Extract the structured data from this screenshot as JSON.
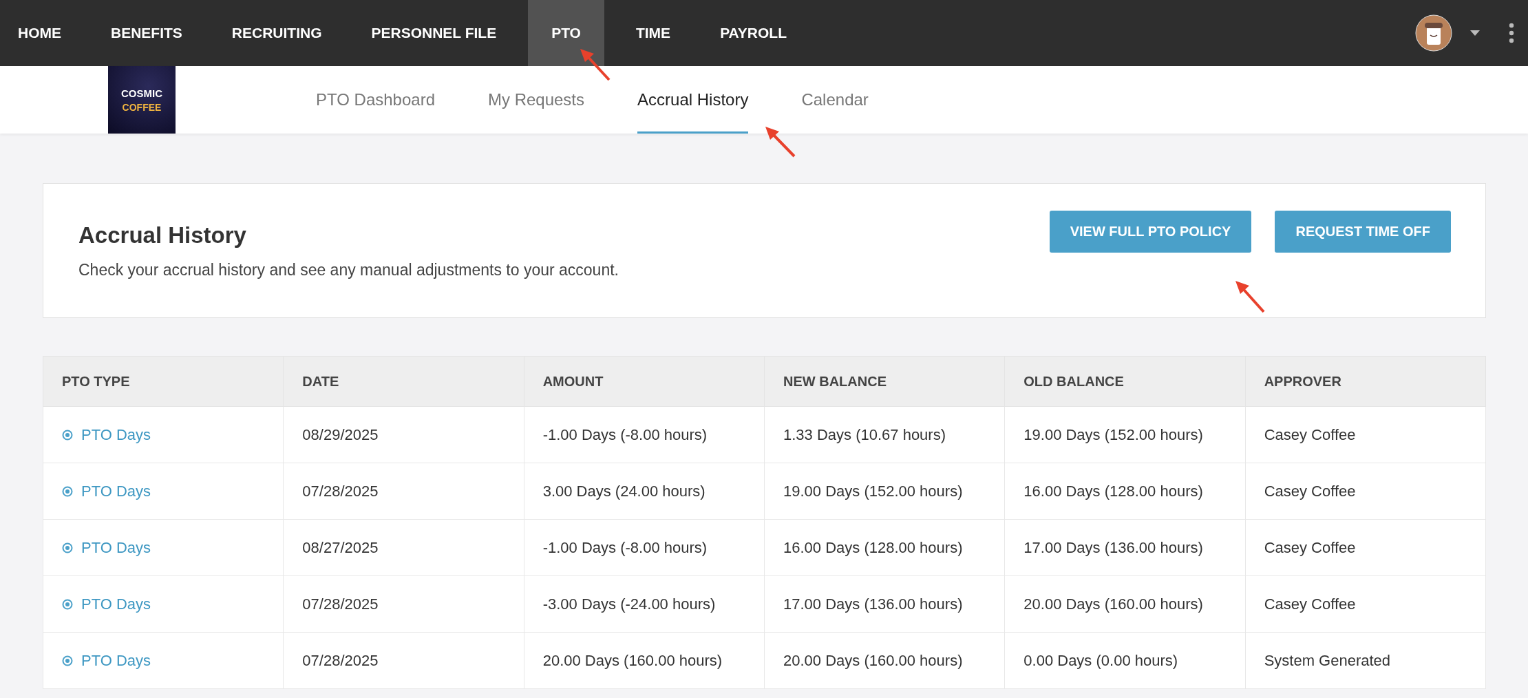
{
  "top_nav": {
    "items": [
      {
        "label": "HOME",
        "selected": false
      },
      {
        "label": "BENEFITS",
        "selected": false
      },
      {
        "label": "RECRUITING",
        "selected": false
      },
      {
        "label": "PERSONNEL FILE",
        "selected": false
      },
      {
        "label": "PTO",
        "selected": true
      },
      {
        "label": "TIME",
        "selected": false
      },
      {
        "label": "PAYROLL",
        "selected": false
      }
    ]
  },
  "logo": {
    "lines": [
      "COSMIC",
      "COFFEE"
    ]
  },
  "tabs": [
    {
      "label": "PTO Dashboard",
      "selected": false
    },
    {
      "label": "My Requests",
      "selected": false
    },
    {
      "label": "Accrual History",
      "selected": true
    },
    {
      "label": "Calendar",
      "selected": false
    }
  ],
  "header_card": {
    "title": "Accrual History",
    "description": "Check your accrual history and see any manual adjustments to your account.",
    "buttons": [
      "VIEW FULL PTO POLICY",
      "REQUEST TIME OFF"
    ]
  },
  "table": {
    "columns": [
      "PTO TYPE",
      "DATE",
      "AMOUNT",
      "NEW BALANCE",
      "OLD BALANCE",
      "APPROVER"
    ],
    "rows": [
      [
        "PTO Days",
        "08/29/2025",
        "-1.00 Days (-8.00 hours)",
        "1.33 Days (10.67 hours)",
        "19.00 Days (152.00 hours)",
        "Casey Coffee"
      ],
      [
        "PTO Days",
        "07/28/2025",
        "3.00 Days (24.00 hours)",
        "19.00 Days (152.00 hours)",
        "16.00 Days (128.00 hours)",
        "Casey Coffee"
      ],
      [
        "PTO Days",
        "08/27/2025",
        "-1.00 Days (-8.00 hours)",
        "16.00 Days (128.00 hours)",
        "17.00 Days (136.00 hours)",
        "Casey Coffee"
      ],
      [
        "PTO Days",
        "07/28/2025",
        "-3.00 Days (-24.00 hours)",
        "17.00 Days (136.00 hours)",
        "20.00 Days (160.00 hours)",
        "Casey Coffee"
      ],
      [
        "PTO Days",
        "07/28/2025",
        "20.00 Days (160.00 hours)",
        "20.00 Days (160.00 hours)",
        "0.00 Days (0.00 hours)",
        "System Generated"
      ]
    ]
  }
}
